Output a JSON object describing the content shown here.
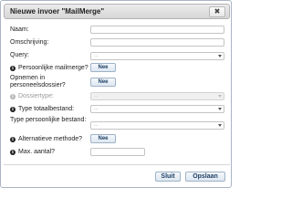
{
  "dialog": {
    "title": "Nieuwe invoer \"MailMerge\"",
    "close_label": "✖"
  },
  "fields": {
    "naam_label": "Naam:",
    "omschrijving_label": "Omschrijving:",
    "query_label": "Query:",
    "query_value": "...",
    "persoonlijke_mailmerge_label": "Persoonlijke mailmerge?",
    "persoonlijke_mailmerge_value": "Nee",
    "opnemen_line1": "Opnemen in",
    "opnemen_line2": "personeelsdossier?",
    "opnemen_value": "Nee",
    "dossiertype_label": "Dossiertype:",
    "dossiertype_value": "...",
    "type_totaalbestand_label": "Type totaalbestand:",
    "type_totaalbestand_value": "...",
    "type_persoonlijke_line1": "Type persoonlijke bestand:",
    "type_persoonlijke_value": "...",
    "alternatieve_methode_label": "Alternatieve methode?",
    "alternatieve_methode_value": "Nee",
    "max_aantal_label": "Max. aantal?"
  },
  "footer": {
    "sluit_label": "Sluit",
    "opslaan_label": "Opslaan"
  },
  "icons": {
    "info": "info-icon",
    "close": "close-icon",
    "caret": "chevron-down-icon"
  },
  "colors": {
    "accent": "#1e3f66",
    "disabled": "#9a9a9a"
  }
}
